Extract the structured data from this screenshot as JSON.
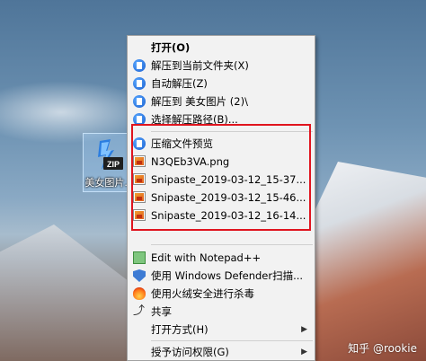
{
  "desktop_icon": {
    "label": "美女图片.z",
    "badge": "ZIP"
  },
  "menu": {
    "open": "打开(O)",
    "extract_here": "解压到当前文件夹(X)",
    "auto_extract": "自动解压(Z)",
    "extract_to": "解压到 美女图片 (2)\\",
    "choose_path": "选择解压路径(B)...",
    "preview_title": "压缩文件预览",
    "preview_files": [
      "N3QEb3VA.png",
      "Snipaste_2019-03-12_15-37...",
      "Snipaste_2019-03-12_15-46...",
      "Snipaste_2019-03-12_16-14..."
    ],
    "notepad": "Edit with Notepad++",
    "defender": "使用 Windows Defender扫描...",
    "huorong": "使用火绒安全进行杀毒",
    "share": "共享",
    "open_with": "打开方式(H)",
    "grant_access": "授予访问权限(G)"
  },
  "watermark": "知乎 @rookie",
  "colors": {
    "highlight": "#e0141e",
    "menu_bg": "#f2f2f2"
  }
}
